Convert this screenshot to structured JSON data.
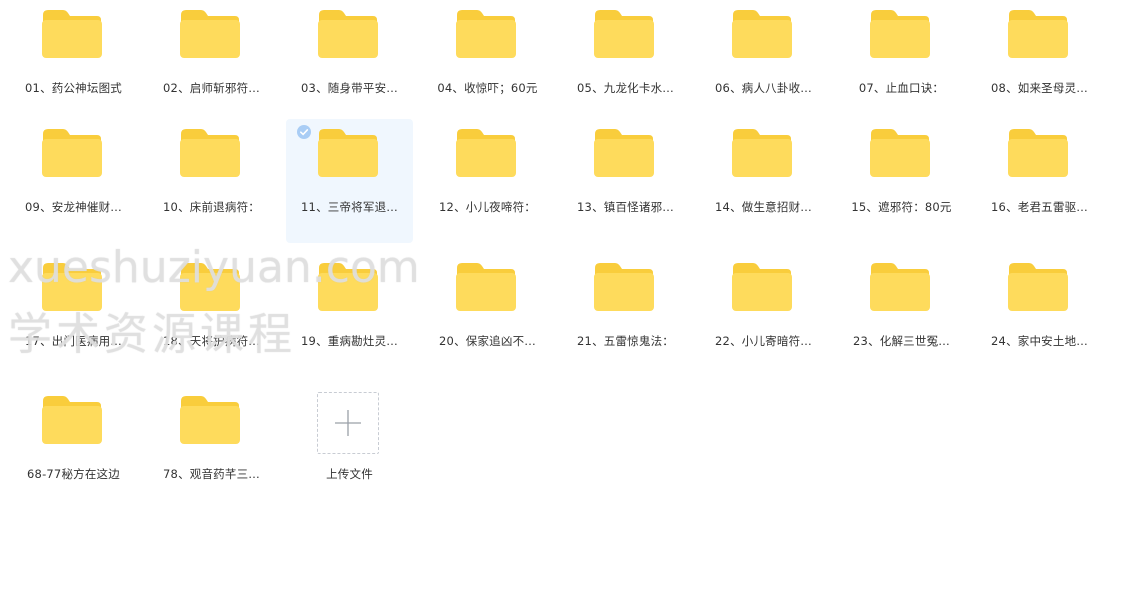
{
  "folders": [
    {
      "label": "01、药公神坛图式"
    },
    {
      "label": "02、启师斩邪符…"
    },
    {
      "label": "03、随身带平安…"
    },
    {
      "label": "04、收惊吓；60元"
    },
    {
      "label": "05、九龙化卡水…"
    },
    {
      "label": "06、病人八卦收…"
    },
    {
      "label": "07、止血口诀："
    },
    {
      "label": "08、如来圣母灵…"
    },
    {
      "label": "09、安龙神催财…"
    },
    {
      "label": "10、床前退病符："
    },
    {
      "label": "11、三帝将军退…",
      "selected": true
    },
    {
      "label": "12、小儿夜啼符："
    },
    {
      "label": "13、镇百怪诸邪…"
    },
    {
      "label": "14、做生意招财…"
    },
    {
      "label": "15、遮邪符：80元"
    },
    {
      "label": "16、老君五雷驱…"
    },
    {
      "label": "17、出门医病用…"
    },
    {
      "label": "18、天将护病符…"
    },
    {
      "label": "19、重病勘灶灵…"
    },
    {
      "label": "20、保家追凶不…"
    },
    {
      "label": "21、五雷惊鬼法："
    },
    {
      "label": "22、小儿寄暗符…"
    },
    {
      "label": "23、化解三世冤…"
    },
    {
      "label": "24、家中安土地…"
    },
    {
      "label": "68-77秘方在这边"
    },
    {
      "label": "78、观音药芊三…"
    }
  ],
  "upload": {
    "label": "上传文件"
  },
  "watermark": {
    "line1": "xueshuziyuan.com",
    "line2": "学术资源课程"
  },
  "colors": {
    "folder_back": "#f9cd3c",
    "folder_front": "#fedb5c",
    "selected_bg": "#f0f7fe",
    "check": "#a9cdf5"
  },
  "icons": {
    "folder": "folder-icon",
    "check": "check-circle-icon",
    "upload": "plus-icon"
  }
}
